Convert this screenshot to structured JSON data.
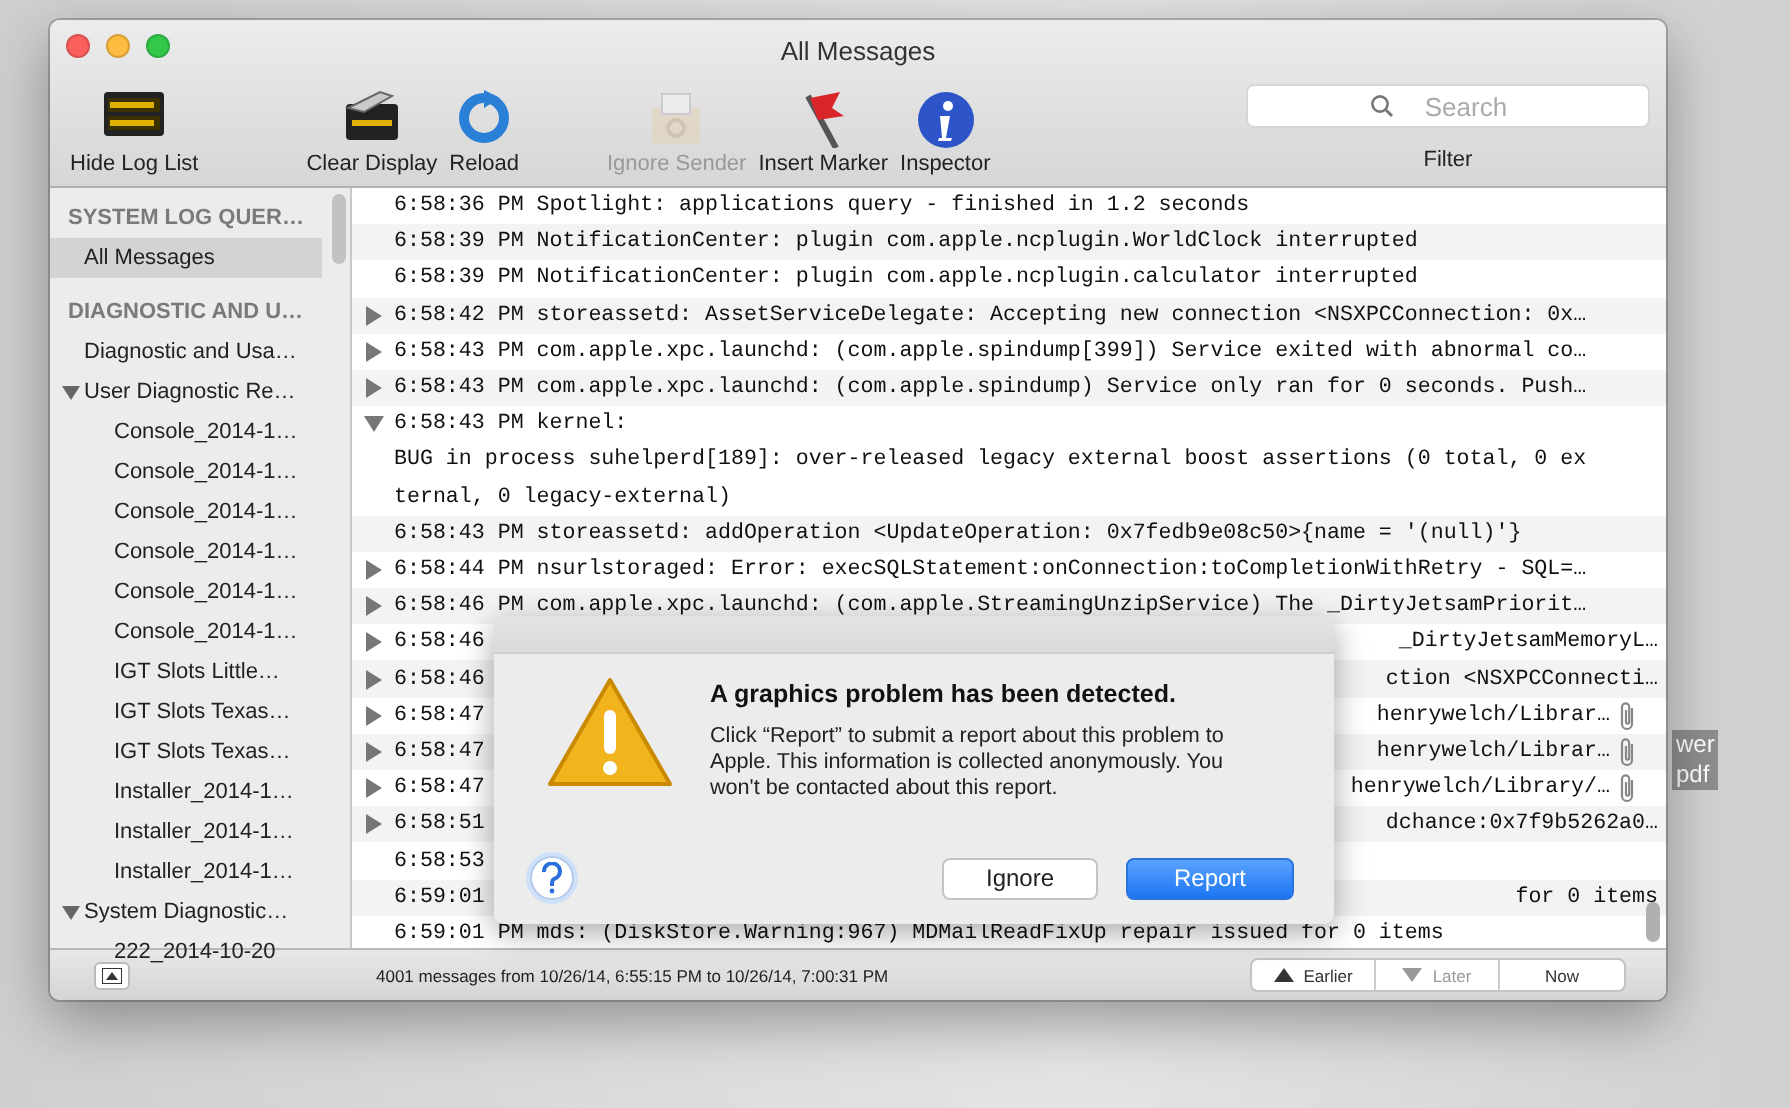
{
  "desktop": {
    "icon_label_lines": [
      "wer",
      "pdf"
    ]
  },
  "window": {
    "title": "All Messages"
  },
  "toolbar": {
    "tools": [
      {
        "kind": "log",
        "label": "Hide Log List",
        "disabled": false
      },
      {
        "kind": "clear",
        "label": "Clear Display",
        "disabled": false
      },
      {
        "kind": "reload",
        "label": "Reload",
        "disabled": false
      },
      {
        "kind": "ignore",
        "label": "Ignore Sender",
        "disabled": true
      },
      {
        "kind": "marker",
        "label": "Insert Marker",
        "disabled": false
      },
      {
        "kind": "inspector",
        "label": "Inspector",
        "disabled": false
      }
    ],
    "search": {
      "placeholder": "Search",
      "label": "Filter"
    }
  },
  "sidebar": {
    "sections": [
      {
        "title": "SYSTEM LOG QUER…",
        "items": [
          {
            "label": "All Messages",
            "selected": true
          }
        ]
      },
      {
        "title": "DIAGNOSTIC AND U…",
        "items": [
          {
            "label": "Diagnostic and Usa…",
            "selected": false
          },
          {
            "label": "User Diagnostic Re…",
            "selected": false,
            "expanded": true,
            "children": [
              {
                "label": "Console_2014-1…",
                "selected": false
              },
              {
                "label": "Console_2014-1…",
                "selected": false
              },
              {
                "label": "Console_2014-1…",
                "selected": false
              },
              {
                "label": "Console_2014-1…",
                "selected": false
              },
              {
                "label": "Console_2014-1…",
                "selected": false
              },
              {
                "label": "Console_2014-1…",
                "selected": false
              },
              {
                "label": "IGT Slots Little…",
                "selected": false
              },
              {
                "label": "IGT Slots Texas…",
                "selected": false
              },
              {
                "label": "IGT Slots Texas…",
                "selected": false
              },
              {
                "label": "Installer_2014-1…",
                "selected": false
              },
              {
                "label": "Installer_2014-1…",
                "selected": false
              },
              {
                "label": "Installer_2014-1…",
                "selected": false
              }
            ]
          },
          {
            "label": "System Diagnostic…",
            "selected": false,
            "expanded": true,
            "children": [
              {
                "label": "222_2014-10-20",
                "selected": false
              }
            ]
          }
        ]
      }
    ]
  },
  "log": {
    "rows": [
      {
        "expandable": false,
        "text": "6:58:36 PM Spotlight: applications query - finished in 1.2 seconds"
      },
      {
        "expandable": false,
        "text": "6:58:39 PM NotificationCenter: plugin com.apple.ncplugin.WorldClock interrupted"
      },
      {
        "expandable": false,
        "text": "6:58:39 PM NotificationCenter: plugin com.apple.ncplugin.calculator interrupted"
      },
      {
        "expandable": true,
        "expanded": false,
        "text": "6:58:42 PM storeassetd: AssetServiceDelegate: Accepting new connection <NSXPCConnection: 0x…"
      },
      {
        "expandable": true,
        "expanded": false,
        "text": "6:58:43 PM com.apple.xpc.launchd: (com.apple.spindump[399]) Service exited with abnormal co…"
      },
      {
        "expandable": true,
        "expanded": false,
        "text": "6:58:43 PM com.apple.xpc.launchd: (com.apple.spindump) Service only ran for 0 seconds. Push…"
      },
      {
        "expandable": true,
        "expanded": true,
        "text": "6:58:43 PM kernel:",
        "detail": "BUG in process suhelperd[189]: over-released legacy external boost assertions (0 total, 0 external, 0 legacy-external)"
      },
      {
        "expandable": false,
        "text": "6:58:43 PM storeassetd: addOperation <UpdateOperation: 0x7fedb9e08c50>{name = '(null)'}"
      },
      {
        "expandable": true,
        "expanded": false,
        "text": "6:58:44 PM nsurlstoraged: Error: execSQLStatement:onConnection:toCompletionWithRetry - SQL=…"
      },
      {
        "expandable": true,
        "expanded": false,
        "text": "6:58:46 PM com.apple.xpc.launchd: (com.apple.StreamingUnzipService) The _DirtyJetsamPriorit…"
      },
      {
        "expandable": true,
        "expanded": false,
        "text": "6:58:46",
        "tail": "_DirtyJetsamMemoryL…"
      },
      {
        "expandable": true,
        "expanded": false,
        "text": "6:58:46",
        "tail": "ction <NSXPCConnecti…"
      },
      {
        "expandable": true,
        "expanded": false,
        "text": "6:58:47",
        "tail": "henrywelch/Librar…",
        "attachment": true
      },
      {
        "expandable": true,
        "expanded": false,
        "text": "6:58:47",
        "tail": "henrywelch/Librar…",
        "attachment": true
      },
      {
        "expandable": true,
        "expanded": false,
        "text": "6:58:47",
        "tail": "henrywelch/Library/…",
        "attachment": true
      },
      {
        "expandable": true,
        "expanded": false,
        "text": "6:58:51",
        "tail": "dchance:0x7f9b5262a0…"
      },
      {
        "expandable": false,
        "text": "6:58:53"
      },
      {
        "expandable": false,
        "text": "6:59:01",
        "tail": "for 0 items"
      },
      {
        "expandable": false,
        "text": "6:59:01 PM mds: (DiskStore.Warning:967) MDMailReadFixUp repair issued for 0 items"
      }
    ]
  },
  "status_bar": {
    "text": "4001 messages from 10/26/14, 6:55:15 PM to 10/26/14, 7:00:31 PM",
    "nav": [
      {
        "kind": "up",
        "label": "Earlier",
        "disabled": false
      },
      {
        "kind": "down",
        "label": "Later",
        "disabled": true
      },
      {
        "kind": "none",
        "label": "Now",
        "disabled": false
      }
    ]
  },
  "alert": {
    "title": "A graphics problem has been detected.",
    "message": "Click “Report” to submit a report about this problem to Apple. This information is collected anonymously. You won't be contacted about this report.",
    "buttons": [
      {
        "label": "Ignore",
        "default": false
      },
      {
        "label": "Report",
        "default": true
      }
    ]
  }
}
